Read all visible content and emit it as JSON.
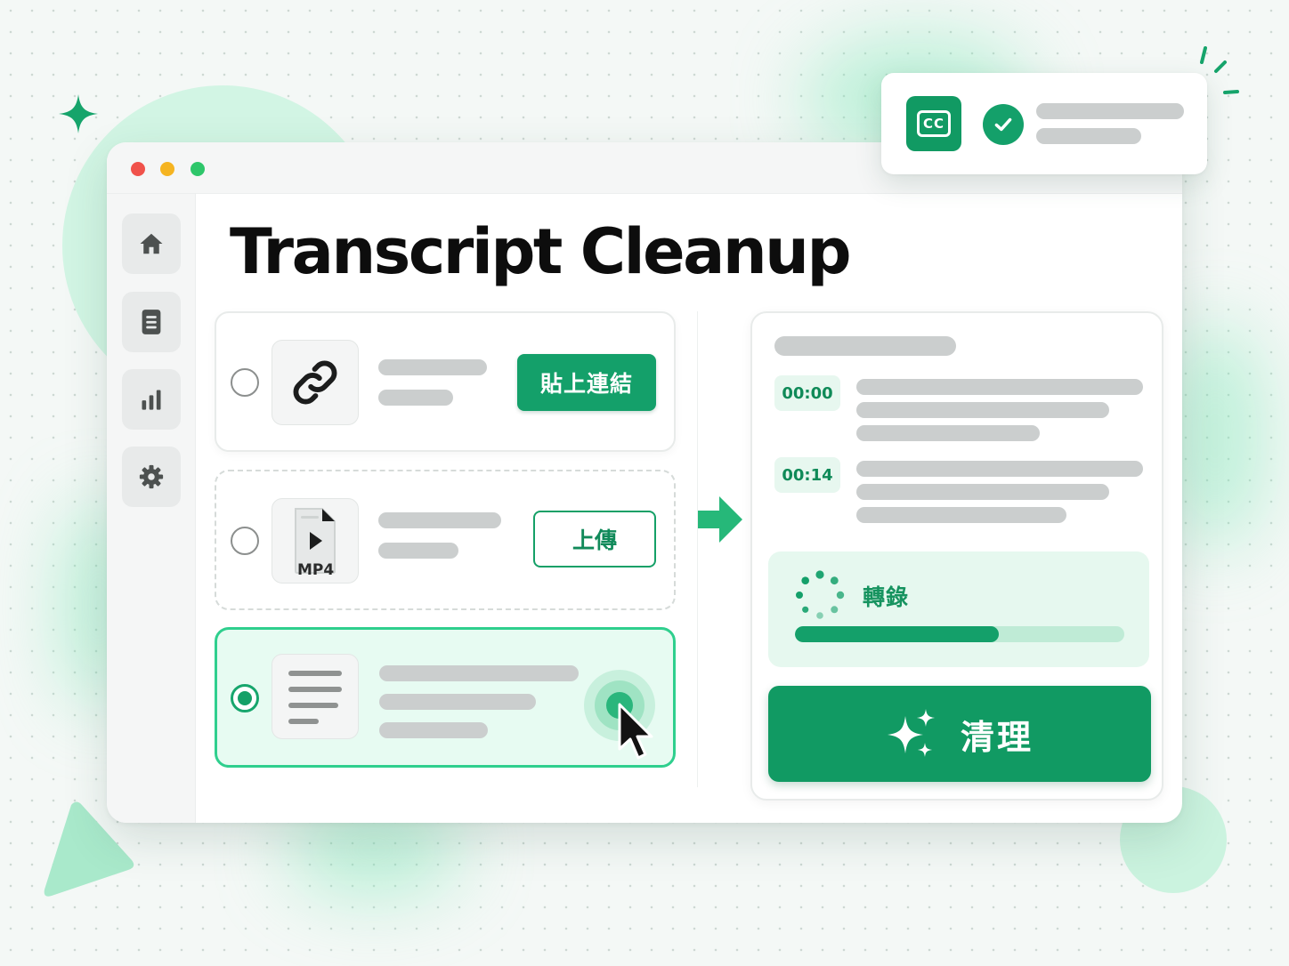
{
  "page": {
    "title": "Transcript Cleanup"
  },
  "sidebar": {
    "items": [
      {
        "icon": "home-icon"
      },
      {
        "icon": "document-icon"
      },
      {
        "icon": "chart-icon"
      },
      {
        "icon": "gear-icon"
      }
    ]
  },
  "options": [
    {
      "icon": "link-icon",
      "button_label": "貼上連結",
      "selected": false
    },
    {
      "icon": "video-file-icon",
      "file_type": "MP4",
      "button_label": "上傳",
      "selected": false
    },
    {
      "icon": "text-lines-icon",
      "selected": true
    }
  ],
  "result": {
    "segments": [
      {
        "timestamp": "00:00"
      },
      {
        "timestamp": "00:14"
      }
    ],
    "status_label": "轉錄",
    "progress": 0.62,
    "action_label": "清理"
  },
  "caption_card": {
    "badge": "CC",
    "status": "complete"
  },
  "colors": {
    "accent": "#14a06a",
    "accent_light": "#e6f8ef",
    "window_close": "#f0524b",
    "window_minimize": "#f5b421",
    "window_maximize": "#2ec66a"
  }
}
